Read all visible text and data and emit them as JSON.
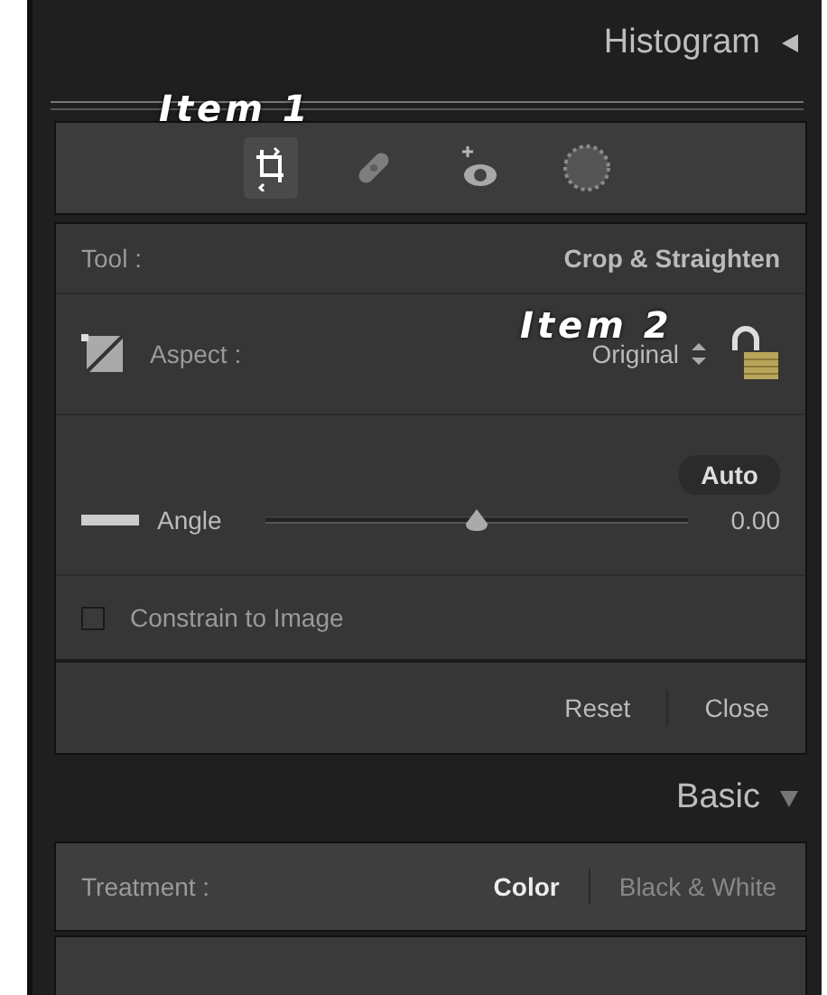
{
  "panels": [
    {
      "title": "Histogram",
      "expanded": false
    },
    {
      "title": "Basic",
      "expanded": true
    }
  ],
  "annotations": [
    {
      "text": "Item 1"
    },
    {
      "text": "Item 2"
    }
  ],
  "tools": [
    {
      "kind": "crop",
      "selected": true
    },
    {
      "kind": "heal",
      "selected": false
    },
    {
      "kind": "redeye",
      "selected": false
    },
    {
      "kind": "mask",
      "selected": false
    }
  ],
  "crop": {
    "tool_label": "Tool :",
    "tool_value": "Crop & Straighten",
    "aspect_label": "Aspect :",
    "aspect_value": "Original",
    "locked": false,
    "auto_button": "Auto",
    "angle_label": "Angle",
    "angle_level": {
      "level": 0.5
    },
    "angle_value": "0.00",
    "constrain": {
      "label": "Constrain to Image",
      "checked": false
    },
    "buttons": [
      "Reset",
      "Close"
    ]
  },
  "treatment": {
    "label": "Treatment :",
    "options": [
      {
        "label": "Color",
        "selected": true
      },
      {
        "label": "Black & White",
        "selected": false
      }
    ]
  }
}
